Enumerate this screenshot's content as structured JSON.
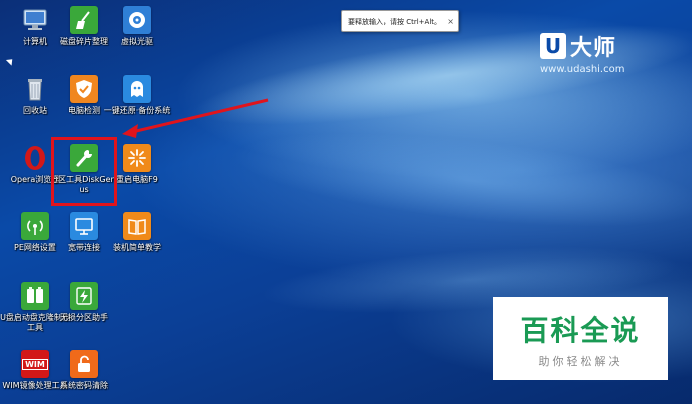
{
  "tooltip": {
    "text": "要释放输入，请按 Ctrl+Alt。",
    "close": "×"
  },
  "brand": {
    "logo_letter": "U",
    "name": "大师",
    "url": "www.udashi.com"
  },
  "watermark": {
    "title": "百科全说",
    "subtitle": "助你轻松解决"
  },
  "desktop_icons": [
    {
      "label": "计算机",
      "icon": "computer-icon",
      "color": "#4a7fc0"
    },
    {
      "label": "磁盘碎片整理",
      "icon": "broom-icon",
      "color": "#3aa83a"
    },
    {
      "label": "虚拟光驱",
      "icon": "disc-icon",
      "color": "#2f7fd6"
    },
    {
      "label": "回收站",
      "icon": "recycle-bin-icon",
      "color": "#8a97a6"
    },
    {
      "label": "电脑检测",
      "icon": "shield-check-icon",
      "color": "#f0861f"
    },
    {
      "label": "一键还原·备份系统",
      "icon": "ghost-icon",
      "color": "#2a8ae0"
    },
    {
      "label": "Opera浏览器",
      "icon": "opera-icon",
      "color": "#d21818"
    },
    {
      "label": "分区工具DiskGenius",
      "icon": "wrench-icon",
      "color": "#3aa83a"
    },
    {
      "label": "重启电脑F9",
      "icon": "sparkle-icon",
      "color": "#f08a1a"
    },
    {
      "label": "PE网络设置",
      "icon": "network-icon",
      "color": "#3aa83a"
    },
    {
      "label": "宽带连接",
      "icon": "monitor-icon",
      "color": "#2a8ae0"
    },
    {
      "label": "装机简单教学",
      "icon": "book-icon",
      "color": "#f08a1a"
    },
    {
      "label": "U盘启动盘克隆制作工具",
      "icon": "usb-clone-icon",
      "color": "#3aa83a"
    },
    {
      "label": "无损分区助手",
      "icon": "lightning-icon",
      "color": "#3aa83a"
    },
    {
      "label": "WIM镜像处理工具",
      "icon": "wim-icon",
      "color": "#d21818",
      "badge": "WIM"
    },
    {
      "label": "系统密码清除",
      "icon": "unlock-icon",
      "color": "#f06a1a"
    }
  ]
}
